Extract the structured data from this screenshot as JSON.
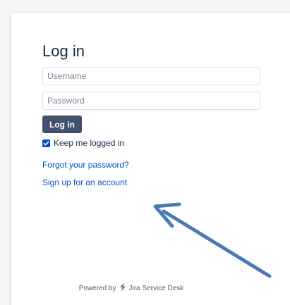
{
  "login": {
    "title": "Log in",
    "username_placeholder": "Username",
    "password_placeholder": "Password",
    "login_button": "Log in",
    "keep_logged_in": "Keep me logged in",
    "keep_logged_in_checked": true,
    "forgot_password": "Forgot your password?",
    "sign_up": "Sign up for an account"
  },
  "footer": {
    "powered_by": "Powered by",
    "product": "Jira Service Desk",
    "logo_icon": "jira-service-desk-bolt-icon"
  },
  "annotation": {
    "arrow_color": "#4a79b5",
    "arrow_icon": "annotation-arrow"
  }
}
